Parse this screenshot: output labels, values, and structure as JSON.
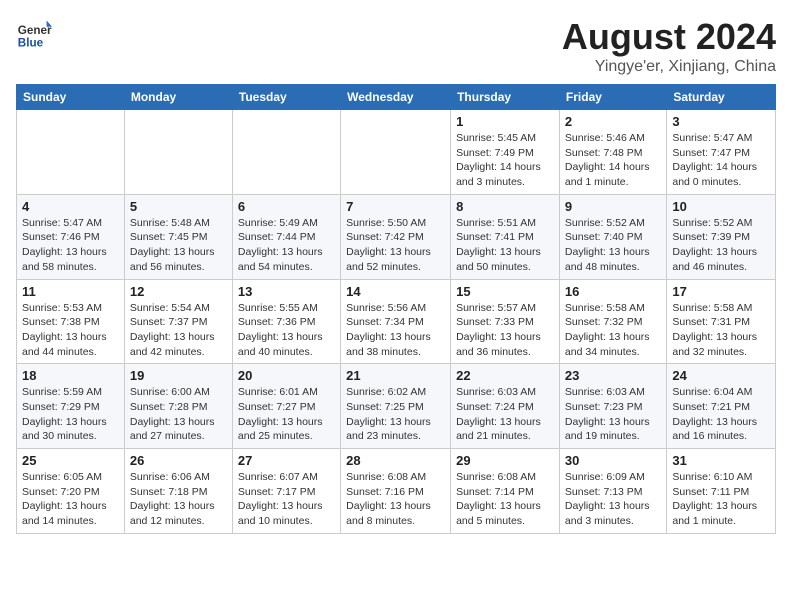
{
  "logo": {
    "general": "General",
    "blue": "Blue"
  },
  "title": "August 2024",
  "subtitle": "Yingye'er, Xinjiang, China",
  "days_of_week": [
    "Sunday",
    "Monday",
    "Tuesday",
    "Wednesday",
    "Thursday",
    "Friday",
    "Saturday"
  ],
  "weeks": [
    [
      {
        "day": "",
        "info": ""
      },
      {
        "day": "",
        "info": ""
      },
      {
        "day": "",
        "info": ""
      },
      {
        "day": "",
        "info": ""
      },
      {
        "day": "1",
        "info": "Sunrise: 5:45 AM\nSunset: 7:49 PM\nDaylight: 14 hours\nand 3 minutes."
      },
      {
        "day": "2",
        "info": "Sunrise: 5:46 AM\nSunset: 7:48 PM\nDaylight: 14 hours\nand 1 minute."
      },
      {
        "day": "3",
        "info": "Sunrise: 5:47 AM\nSunset: 7:47 PM\nDaylight: 14 hours\nand 0 minutes."
      }
    ],
    [
      {
        "day": "4",
        "info": "Sunrise: 5:47 AM\nSunset: 7:46 PM\nDaylight: 13 hours\nand 58 minutes."
      },
      {
        "day": "5",
        "info": "Sunrise: 5:48 AM\nSunset: 7:45 PM\nDaylight: 13 hours\nand 56 minutes."
      },
      {
        "day": "6",
        "info": "Sunrise: 5:49 AM\nSunset: 7:44 PM\nDaylight: 13 hours\nand 54 minutes."
      },
      {
        "day": "7",
        "info": "Sunrise: 5:50 AM\nSunset: 7:42 PM\nDaylight: 13 hours\nand 52 minutes."
      },
      {
        "day": "8",
        "info": "Sunrise: 5:51 AM\nSunset: 7:41 PM\nDaylight: 13 hours\nand 50 minutes."
      },
      {
        "day": "9",
        "info": "Sunrise: 5:52 AM\nSunset: 7:40 PM\nDaylight: 13 hours\nand 48 minutes."
      },
      {
        "day": "10",
        "info": "Sunrise: 5:52 AM\nSunset: 7:39 PM\nDaylight: 13 hours\nand 46 minutes."
      }
    ],
    [
      {
        "day": "11",
        "info": "Sunrise: 5:53 AM\nSunset: 7:38 PM\nDaylight: 13 hours\nand 44 minutes."
      },
      {
        "day": "12",
        "info": "Sunrise: 5:54 AM\nSunset: 7:37 PM\nDaylight: 13 hours\nand 42 minutes."
      },
      {
        "day": "13",
        "info": "Sunrise: 5:55 AM\nSunset: 7:36 PM\nDaylight: 13 hours\nand 40 minutes."
      },
      {
        "day": "14",
        "info": "Sunrise: 5:56 AM\nSunset: 7:34 PM\nDaylight: 13 hours\nand 38 minutes."
      },
      {
        "day": "15",
        "info": "Sunrise: 5:57 AM\nSunset: 7:33 PM\nDaylight: 13 hours\nand 36 minutes."
      },
      {
        "day": "16",
        "info": "Sunrise: 5:58 AM\nSunset: 7:32 PM\nDaylight: 13 hours\nand 34 minutes."
      },
      {
        "day": "17",
        "info": "Sunrise: 5:58 AM\nSunset: 7:31 PM\nDaylight: 13 hours\nand 32 minutes."
      }
    ],
    [
      {
        "day": "18",
        "info": "Sunrise: 5:59 AM\nSunset: 7:29 PM\nDaylight: 13 hours\nand 30 minutes."
      },
      {
        "day": "19",
        "info": "Sunrise: 6:00 AM\nSunset: 7:28 PM\nDaylight: 13 hours\nand 27 minutes."
      },
      {
        "day": "20",
        "info": "Sunrise: 6:01 AM\nSunset: 7:27 PM\nDaylight: 13 hours\nand 25 minutes."
      },
      {
        "day": "21",
        "info": "Sunrise: 6:02 AM\nSunset: 7:25 PM\nDaylight: 13 hours\nand 23 minutes."
      },
      {
        "day": "22",
        "info": "Sunrise: 6:03 AM\nSunset: 7:24 PM\nDaylight: 13 hours\nand 21 minutes."
      },
      {
        "day": "23",
        "info": "Sunrise: 6:03 AM\nSunset: 7:23 PM\nDaylight: 13 hours\nand 19 minutes."
      },
      {
        "day": "24",
        "info": "Sunrise: 6:04 AM\nSunset: 7:21 PM\nDaylight: 13 hours\nand 16 minutes."
      }
    ],
    [
      {
        "day": "25",
        "info": "Sunrise: 6:05 AM\nSunset: 7:20 PM\nDaylight: 13 hours\nand 14 minutes."
      },
      {
        "day": "26",
        "info": "Sunrise: 6:06 AM\nSunset: 7:18 PM\nDaylight: 13 hours\nand 12 minutes."
      },
      {
        "day": "27",
        "info": "Sunrise: 6:07 AM\nSunset: 7:17 PM\nDaylight: 13 hours\nand 10 minutes."
      },
      {
        "day": "28",
        "info": "Sunrise: 6:08 AM\nSunset: 7:16 PM\nDaylight: 13 hours\nand 8 minutes."
      },
      {
        "day": "29",
        "info": "Sunrise: 6:08 AM\nSunset: 7:14 PM\nDaylight: 13 hours\nand 5 minutes."
      },
      {
        "day": "30",
        "info": "Sunrise: 6:09 AM\nSunset: 7:13 PM\nDaylight: 13 hours\nand 3 minutes."
      },
      {
        "day": "31",
        "info": "Sunrise: 6:10 AM\nSunset: 7:11 PM\nDaylight: 13 hours\nand 1 minute."
      }
    ]
  ]
}
